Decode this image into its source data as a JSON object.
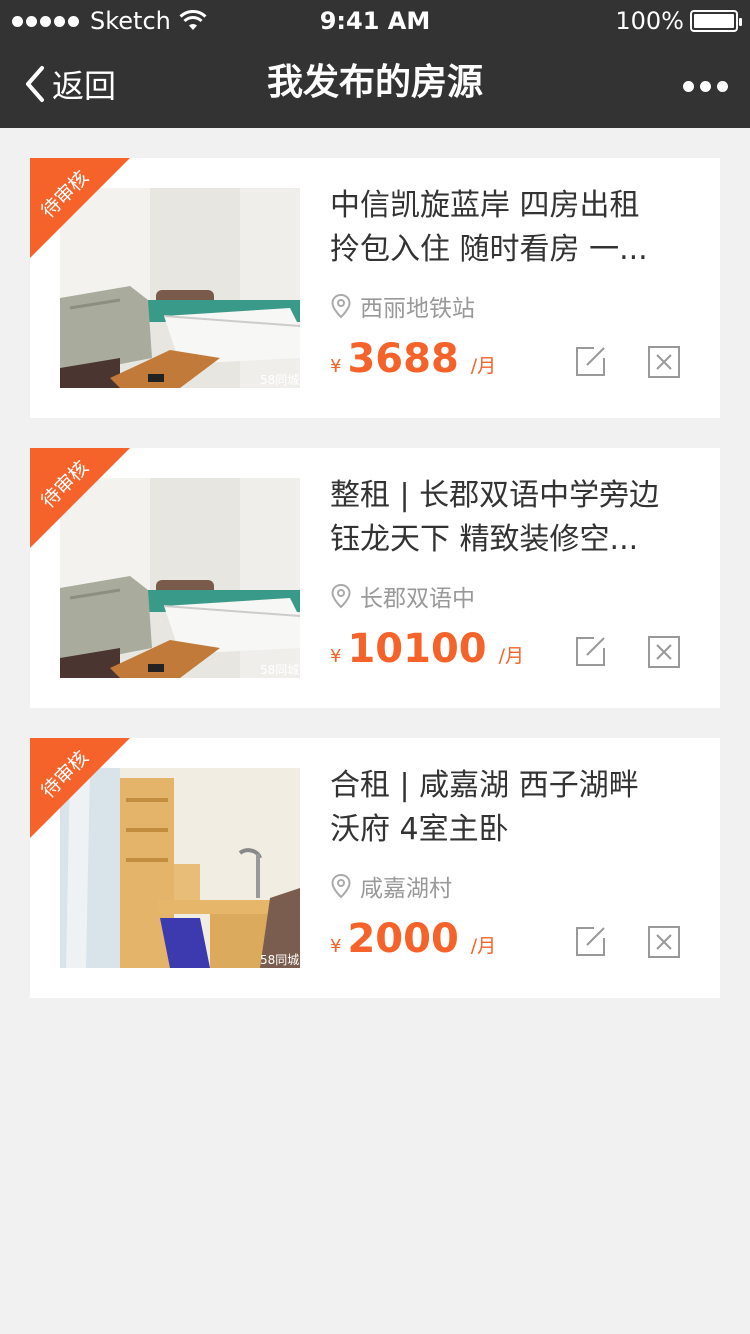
{
  "status_bar": {
    "carrier": "Sketch",
    "time": "9:41 AM",
    "battery": "100%"
  },
  "nav": {
    "back_label": "返回",
    "title": "我发布的房源"
  },
  "listings": [
    {
      "badge": "待审核",
      "title_line1": "中信凯旋蓝岸  四房出租",
      "title_line2": "拎包入住 随时看房 一...",
      "location": "西丽地铁站",
      "currency": "¥",
      "price": "3688",
      "unit": "/月",
      "image_watermark": "58同城"
    },
    {
      "badge": "待审核",
      "title_line1": "整租 | 长郡双语中学旁边",
      "title_line2": "钰龙天下  精致装修空...",
      "location": "长郡双语中",
      "currency": "¥",
      "price": "10100",
      "unit": "/月",
      "image_watermark": "58同城"
    },
    {
      "badge": "待审核",
      "title_line1": "合租 | 咸嘉湖 西子湖畔",
      "title_line2": "沃府 4室主卧",
      "location": "咸嘉湖村",
      "currency": "¥",
      "price": "2000",
      "unit": "/月",
      "image_watermark": "58同城"
    }
  ],
  "colors": {
    "header": "#333333",
    "accent": "#f5632b",
    "background": "#f1f1f1"
  },
  "icons": [
    "back-chevron-icon",
    "more-icon",
    "location-pin-icon",
    "edit-icon",
    "delete-icon",
    "wifi-icon",
    "battery-icon"
  ]
}
